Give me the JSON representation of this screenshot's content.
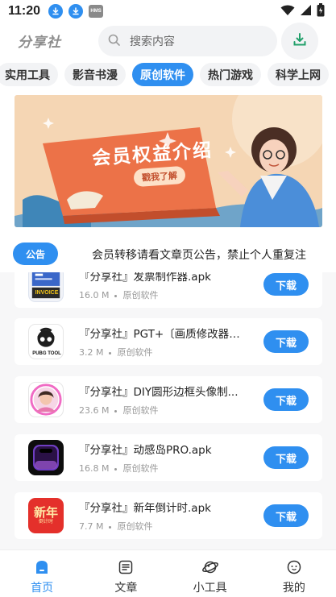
{
  "status_bar": {
    "time": "11:20",
    "hms_label": "HMS"
  },
  "header": {
    "logo": "分享社",
    "search_placeholder": "搜索内容"
  },
  "tabs": [
    {
      "label": "实用工具",
      "active": false
    },
    {
      "label": "影音书漫",
      "active": false
    },
    {
      "label": "原创软件",
      "active": true
    },
    {
      "label": "热门游戏",
      "active": false
    },
    {
      "label": "科学上网",
      "active": false
    }
  ],
  "banner": {
    "title": "会员权益介绍",
    "cta": "戳我了解"
  },
  "notice": {
    "badge": "公告",
    "text": "会员转移请看文章页公告，禁止个人重复注"
  },
  "apps": [
    {
      "title": "『分享社』发票制作器.apk",
      "size": "16.0 M",
      "category": "原创软件",
      "button": "下载",
      "icon": "invoice-app-icon",
      "icon_label": "INVOICE"
    },
    {
      "title": "『分享社』PGT+〔画质修改器〕...",
      "size": "3.2 M",
      "category": "原创软件",
      "button": "下载",
      "icon": "pgt-app-icon",
      "icon_label": "PUBG TOOL"
    },
    {
      "title": "『分享社』DIY圆形边框头像制...",
      "size": "23.6 M",
      "category": "原创软件",
      "button": "下载",
      "icon": "avatar-frame-app-icon"
    },
    {
      "title": "『分享社』动感岛PRO.apk",
      "size": "16.8 M",
      "category": "原创软件",
      "button": "下载",
      "icon": "dynamic-island-app-icon"
    },
    {
      "title": "『分享社』新年倒计时.apk",
      "size": "7.7 M",
      "category": "原创软件",
      "button": "下载",
      "icon": "new-year-countdown-app-icon",
      "icon_label": "新年",
      "icon_sublabel": "倒计时"
    }
  ],
  "bottom_nav": [
    {
      "label": "首页",
      "icon": "home-icon",
      "active": true
    },
    {
      "label": "文章",
      "icon": "article-icon",
      "active": false
    },
    {
      "label": "小工具",
      "icon": "tools-icon",
      "active": false
    },
    {
      "label": "我的",
      "icon": "profile-icon",
      "active": false
    }
  ],
  "colors": {
    "accent": "#2f8ff0",
    "banner_bg": "#f5d6b4",
    "banner_flag": "#ec7248"
  }
}
